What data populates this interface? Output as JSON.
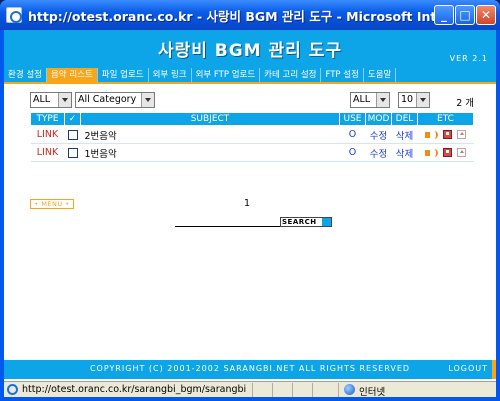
{
  "window": {
    "title": "http://otest.oranc.co.kr - 사랑비 BGM 관리 도구 - Microsoft Internet Ex...",
    "min_label": "_",
    "max_label": "□",
    "close_label": "✕"
  },
  "banner": {
    "title": "사랑비 BGM 관리 도구",
    "version": "VER 2.1"
  },
  "menu": {
    "items": [
      {
        "label": "환경 설정"
      },
      {
        "label": "음악 리스트"
      },
      {
        "label": "파일 업로드"
      },
      {
        "label": "외부 링크"
      },
      {
        "label": "외부 FTP 업로드"
      },
      {
        "label": "카테 고리 설정"
      },
      {
        "label": "FTP 설정"
      },
      {
        "label": "도움말"
      }
    ]
  },
  "filters": {
    "type_select": "ALL",
    "category_select": "All Category",
    "use_select": "ALL",
    "per_page_select": "10",
    "count": "2 개"
  },
  "table": {
    "headers": [
      "TYPE",
      "✓",
      "SUBJECT",
      "USE",
      "MOD",
      "DEL",
      "ETC"
    ],
    "rows": [
      {
        "type": "LINK",
        "subject": "2번음악",
        "use": "O",
        "mod": "수정",
        "del": "삭제"
      },
      {
        "type": "LINK",
        "subject": "1번음악",
        "use": "O",
        "mod": "수정",
        "del": "삭제"
      }
    ]
  },
  "pager": {
    "current": "1",
    "menu_label": "• MENU •"
  },
  "search": {
    "button_label": "SEARCH"
  },
  "footer": {
    "copyright": "COPYRIGHT (C) 2001-2002 SARANGBI.NET ALL RIGHTS RESERVED",
    "logout": "LOGOUT"
  },
  "statusbar": {
    "url": "http://otest.oranc.co.kr/sarangbi_bgm/sarangbi",
    "zone": "인터넷"
  }
}
